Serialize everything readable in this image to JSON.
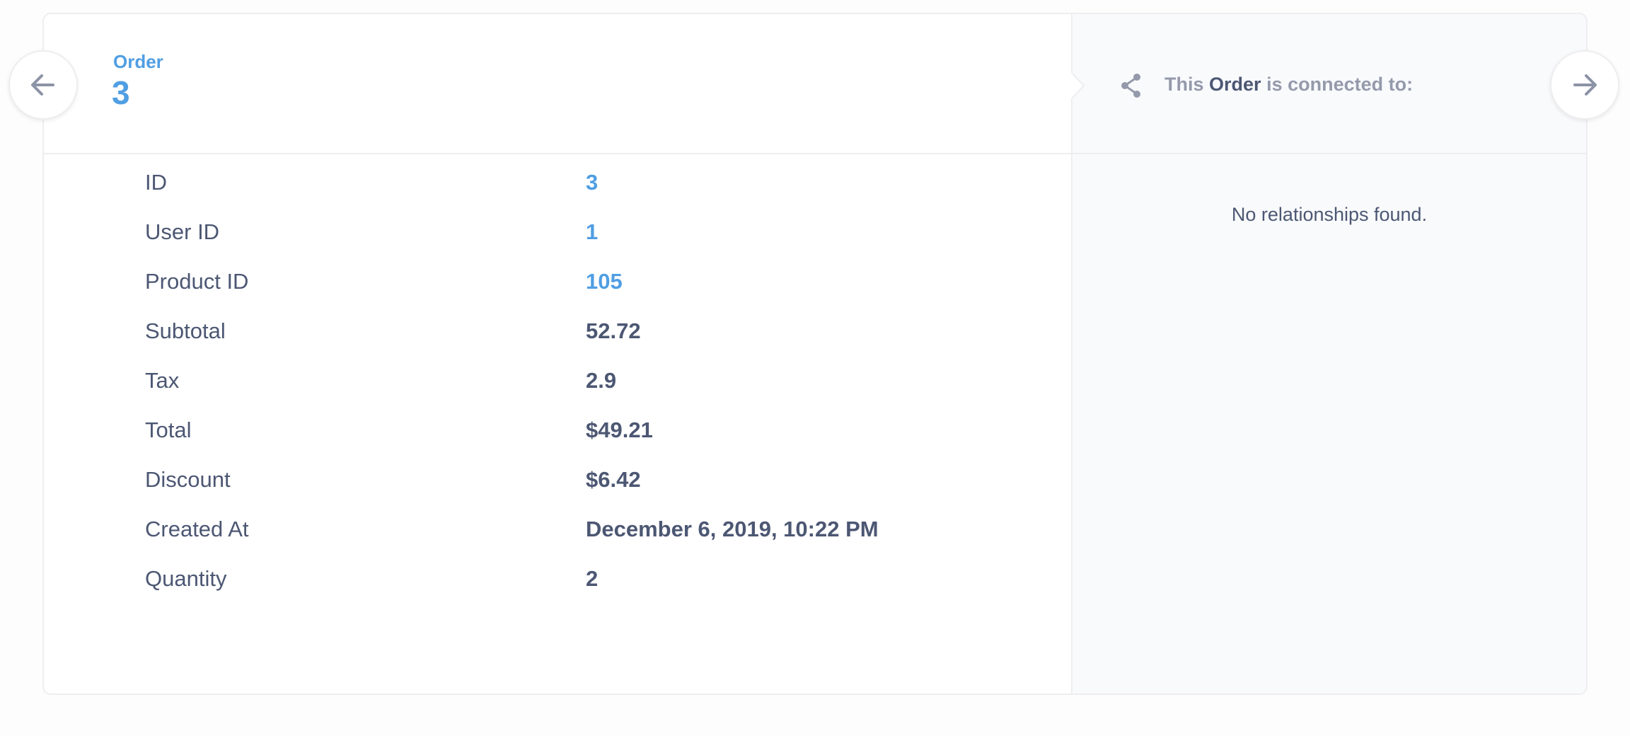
{
  "header": {
    "entity_type": "Order",
    "entity_id": "3"
  },
  "fields": [
    {
      "label": "ID",
      "value": "3",
      "is_link": true
    },
    {
      "label": "User ID",
      "value": "1",
      "is_link": true
    },
    {
      "label": "Product ID",
      "value": "105",
      "is_link": true
    },
    {
      "label": "Subtotal",
      "value": "52.72",
      "is_link": false
    },
    {
      "label": "Tax",
      "value": "2.9",
      "is_link": false
    },
    {
      "label": "Total",
      "value": "$49.21",
      "is_link": false
    },
    {
      "label": "Discount",
      "value": "$6.42",
      "is_link": false
    },
    {
      "label": "Created At",
      "value": "December 6, 2019, 10:22 PM",
      "is_link": false
    },
    {
      "label": "Quantity",
      "value": "2",
      "is_link": false
    }
  ],
  "relationships": {
    "title_prefix": "This",
    "title_entity": "Order",
    "title_suffix": "is connected to:",
    "empty_message": "No relationships found."
  },
  "navigation": {
    "prev_icon": "arrow-left-icon",
    "next_icon": "arrow-right-icon"
  },
  "colors": {
    "accent": "#509ee3",
    "text": "#4c5773",
    "muted": "#949aab",
    "panel_bg": "#f9fafc",
    "border": "#eeeef0"
  }
}
